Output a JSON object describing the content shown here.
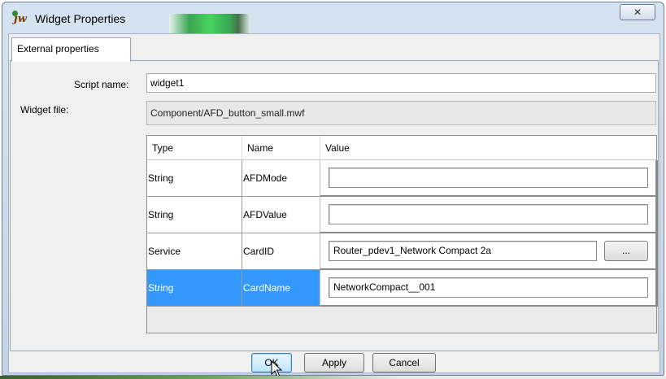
{
  "window": {
    "title": "Widget Properties",
    "close_symbol": "✕"
  },
  "tabs": [
    {
      "label": "External properties",
      "active": true
    }
  ],
  "form": {
    "script_name_label": "Script name:",
    "script_name_value": "widget1",
    "widget_file_label": "Widget file:",
    "widget_file_value": "Component/AFD_button_small.mwf"
  },
  "table": {
    "columns": [
      "Type",
      "Name",
      "Value"
    ],
    "rows": [
      {
        "type": "String",
        "name": "AFDMode",
        "value": "",
        "has_browse": false,
        "selected": false
      },
      {
        "type": "String",
        "name": "AFDValue",
        "value": "",
        "has_browse": false,
        "selected": false
      },
      {
        "type": "Service",
        "name": "CardID",
        "value": "Router_pdev1_Network Compact 2a",
        "has_browse": true,
        "selected": false
      },
      {
        "type": "String",
        "name": "CardName",
        "value": "NetworkCompact__001",
        "has_browse": false,
        "selected": true
      }
    ],
    "browse_label": "..."
  },
  "buttons": {
    "ok": "OK",
    "apply": "Apply",
    "cancel": "Cancel"
  },
  "colors": {
    "selection": "#3399ff",
    "title_bar": "#c4d4e6"
  },
  "icons": {
    "app": "jw-app-icon",
    "close": "close-icon",
    "cursor": "mouse-pointer-icon"
  }
}
